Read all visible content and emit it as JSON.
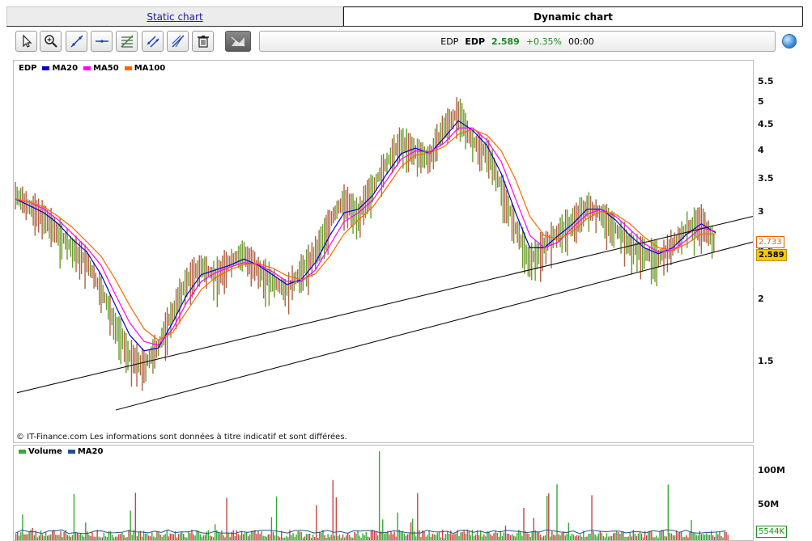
{
  "tabs": [
    {
      "label": "Static chart",
      "active": false
    },
    {
      "label": "Dynamic chart",
      "active": true
    }
  ],
  "toolbar": {
    "tools": [
      {
        "name": "pointer-tool",
        "icon": "cursor-arrow-icon"
      },
      {
        "name": "zoom-tool",
        "icon": "zoom-plus-icon"
      },
      {
        "name": "trendline-tool",
        "icon": "diagonal-line-icon"
      },
      {
        "name": "horizontal-line-tool",
        "icon": "horizontal-line-icon"
      },
      {
        "name": "fibonacci-tool",
        "icon": "fibonacci-icon"
      },
      {
        "name": "parallel-channel-tool",
        "icon": "channel-icon"
      },
      {
        "name": "fan-tool",
        "icon": "fan-lines-icon"
      },
      {
        "name": "delete-tool",
        "icon": "trash-icon"
      },
      {
        "name": "chart-mode-tool",
        "icon": "mountain-chart-icon"
      }
    ]
  },
  "quote": {
    "symbol_short": "EDP",
    "symbol": "EDP",
    "price": "2.589",
    "change": "+0.35%",
    "time": "00:00"
  },
  "colors": {
    "ma20": "#0000cc",
    "ma50": "#ff00ff",
    "ma100": "#ff6600",
    "volume": "#33aa33",
    "volume_ma": "#225588",
    "candle_up": "#6a9a2a",
    "candle_down": "#b06040"
  },
  "legend": {
    "price": [
      {
        "label": "EDP",
        "color": ""
      },
      {
        "label": "MA20",
        "color": "#0000cc"
      },
      {
        "label": "MA50",
        "color": "#ff00ff"
      },
      {
        "label": "MA100",
        "color": "#ff6600"
      }
    ],
    "volume": [
      {
        "label": "Volume",
        "color": "#33aa33"
      },
      {
        "label": "MA20",
        "color": "#225588"
      }
    ]
  },
  "price_axis": {
    "ticks": [
      "5.5",
      "5",
      "4.5",
      "4",
      "3.5",
      "3",
      "2.5",
      "2",
      "1.5"
    ],
    "tick_values": [
      5.5,
      5,
      4.5,
      4,
      3.5,
      3,
      2.5,
      2,
      1.5
    ],
    "ma_tag": "2.733",
    "price_tag": "2.589"
  },
  "volume_axis": {
    "ticks": [
      "100M",
      "50M"
    ],
    "current_tag": "5544K"
  },
  "copyright": "© IT-Finance.com Les informations sont données à titre indicatif et sont différées.",
  "chart_data": {
    "type": "line",
    "scale": "log",
    "ylim": [
      1.2,
      5.6
    ],
    "series": [
      {
        "name": "EDP",
        "values": [
          3.3,
          3.1,
          2.95,
          2.75,
          2.55,
          2.4,
          2.1,
          1.8,
          1.55,
          1.48,
          1.62,
          1.9,
          2.2,
          2.35,
          2.25,
          2.4,
          2.5,
          2.3,
          2.2,
          2.1,
          2.3,
          2.5,
          2.9,
          3.2,
          3.0,
          3.4,
          3.8,
          4.2,
          4.0,
          3.9,
          4.5,
          4.8,
          4.2,
          4.0,
          3.4,
          2.8,
          2.4,
          2.6,
          2.75,
          2.9,
          3.1,
          3.0,
          2.8,
          2.6,
          2.5,
          2.45,
          2.6,
          2.8,
          2.9,
          2.589
        ]
      },
      {
        "name": "MA20",
        "values": [
          3.2,
          3.1,
          3.0,
          2.85,
          2.65,
          2.5,
          2.25,
          1.95,
          1.7,
          1.58,
          1.6,
          1.8,
          2.05,
          2.25,
          2.3,
          2.35,
          2.42,
          2.35,
          2.25,
          2.15,
          2.2,
          2.38,
          2.7,
          3.0,
          3.05,
          3.25,
          3.6,
          3.95,
          4.05,
          3.95,
          4.25,
          4.6,
          4.4,
          4.1,
          3.6,
          3.0,
          2.55,
          2.55,
          2.7,
          2.85,
          3.05,
          3.05,
          2.9,
          2.7,
          2.55,
          2.48,
          2.55,
          2.72,
          2.85,
          2.733
        ]
      },
      {
        "name": "MA50",
        "values": [
          3.2,
          3.15,
          3.05,
          2.9,
          2.72,
          2.55,
          2.35,
          2.05,
          1.8,
          1.65,
          1.62,
          1.75,
          1.98,
          2.18,
          2.27,
          2.33,
          2.38,
          2.36,
          2.28,
          2.18,
          2.18,
          2.3,
          2.58,
          2.88,
          3.0,
          3.18,
          3.5,
          3.85,
          4.0,
          3.98,
          4.15,
          4.45,
          4.45,
          4.2,
          3.8,
          3.2,
          2.7,
          2.55,
          2.62,
          2.8,
          2.98,
          3.05,
          2.95,
          2.78,
          2.6,
          2.5,
          2.52,
          2.65,
          2.8,
          2.75
        ]
      },
      {
        "name": "MA100",
        "values": [
          3.2,
          3.15,
          3.08,
          2.95,
          2.8,
          2.62,
          2.45,
          2.2,
          1.95,
          1.75,
          1.66,
          1.72,
          1.9,
          2.1,
          2.22,
          2.3,
          2.36,
          2.37,
          2.32,
          2.24,
          2.2,
          2.26,
          2.45,
          2.72,
          2.9,
          3.08,
          3.38,
          3.72,
          3.92,
          3.96,
          4.08,
          4.32,
          4.42,
          4.3,
          4.0,
          3.5,
          2.95,
          2.7,
          2.65,
          2.75,
          2.92,
          3.02,
          2.98,
          2.85,
          2.68,
          2.55,
          2.52,
          2.6,
          2.72,
          2.72
        ]
      }
    ]
  }
}
